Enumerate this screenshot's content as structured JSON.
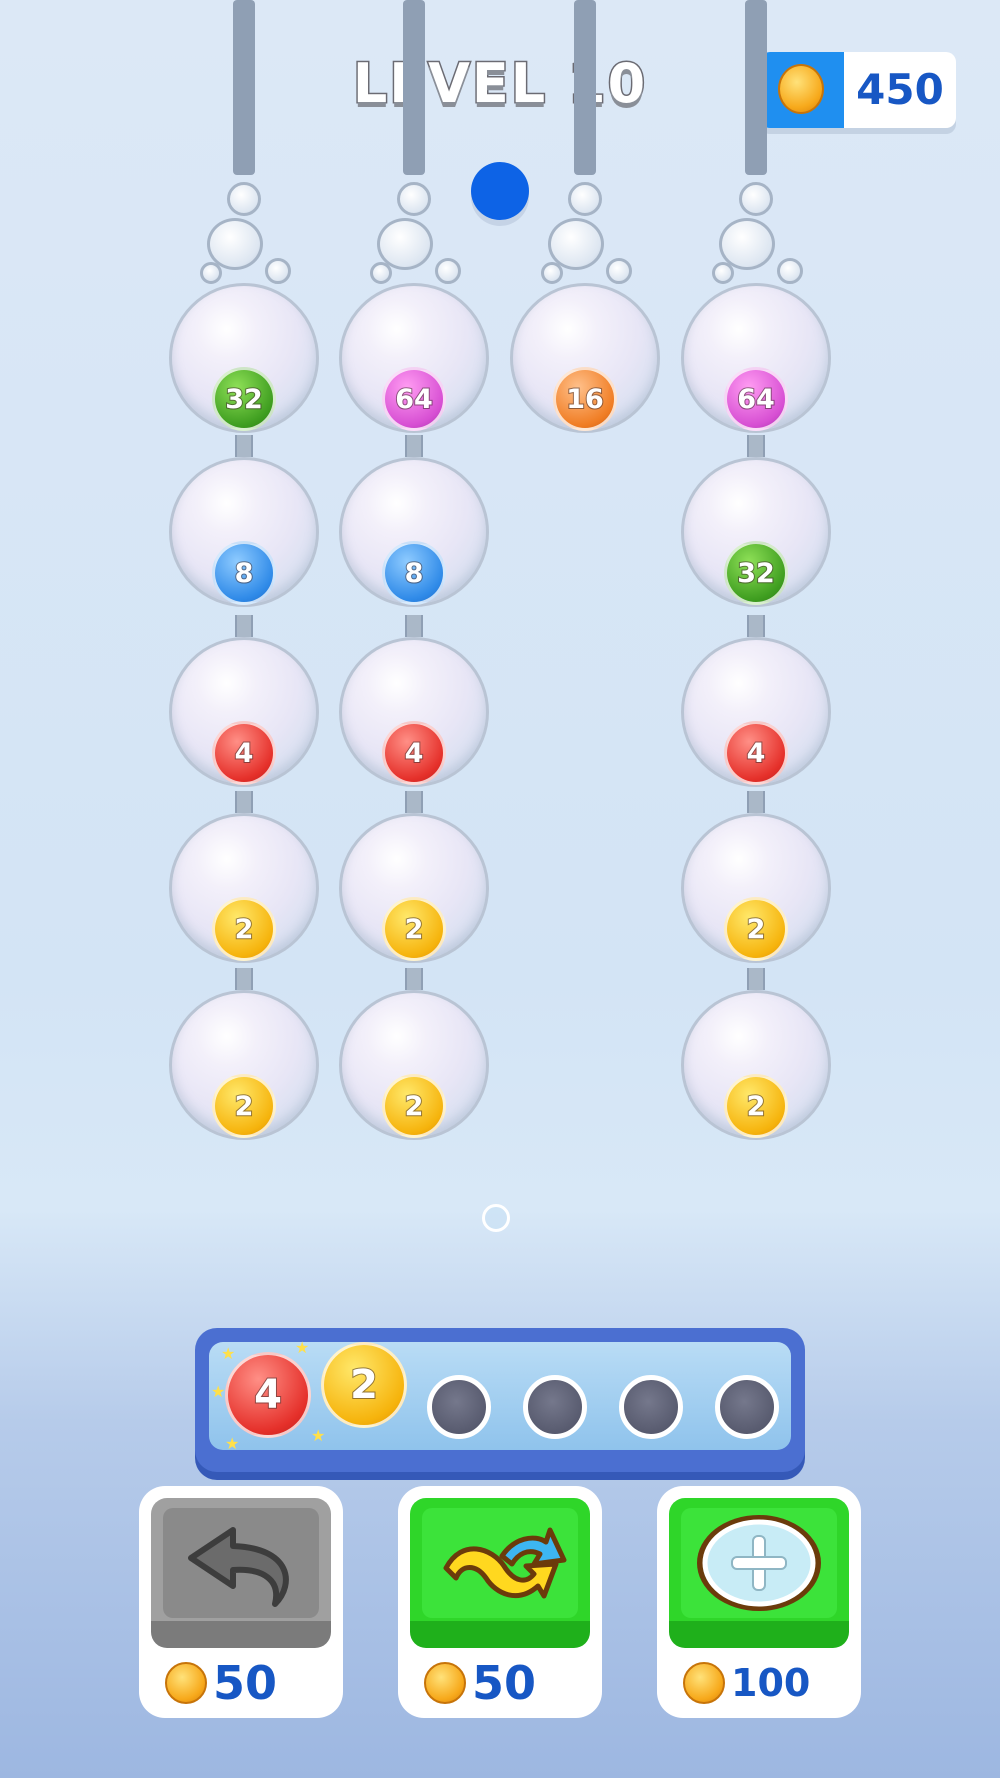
{
  "header": {
    "level_title": "LEVEL 10",
    "coins": "450",
    "coin_icon": "coin-icon",
    "coin_panel_color": "#1f8ff0"
  },
  "board": {
    "columns": [
      {
        "id": "col-1",
        "balls": [
          {
            "value": "32",
            "color": "green"
          },
          {
            "value": "8",
            "color": "blue"
          },
          {
            "value": "4",
            "color": "red"
          },
          {
            "value": "2",
            "color": "yellow"
          },
          {
            "value": "2",
            "color": "yellow"
          }
        ]
      },
      {
        "id": "col-2",
        "balls": [
          {
            "value": "64",
            "color": "pink"
          },
          {
            "value": "8",
            "color": "blue"
          },
          {
            "value": "4",
            "color": "red"
          },
          {
            "value": "2",
            "color": "yellow"
          },
          {
            "value": "2",
            "color": "yellow"
          }
        ]
      },
      {
        "id": "col-3",
        "balls": [
          {
            "value": "16",
            "color": "orange"
          }
        ]
      },
      {
        "id": "col-4",
        "balls": [
          {
            "value": "64",
            "color": "pink"
          },
          {
            "value": "32",
            "color": "green"
          },
          {
            "value": "4",
            "color": "red"
          },
          {
            "value": "2",
            "color": "yellow"
          },
          {
            "value": "2",
            "color": "yellow"
          }
        ]
      }
    ],
    "falling_ball_color": "#0d63e6"
  },
  "tray": {
    "balls": [
      {
        "value": "4",
        "color": "red"
      },
      {
        "value": "2",
        "color": "yellow"
      }
    ],
    "empty_slots": 4
  },
  "powerups": [
    {
      "name": "undo",
      "icon": "undo-arrow-icon",
      "price": "50",
      "enabled": false
    },
    {
      "name": "shuffle",
      "icon": "shuffle-arrows-icon",
      "price": "50",
      "enabled": true
    },
    {
      "name": "add-slot",
      "icon": "plus-circle-icon",
      "price": "100",
      "enabled": true
    }
  ]
}
